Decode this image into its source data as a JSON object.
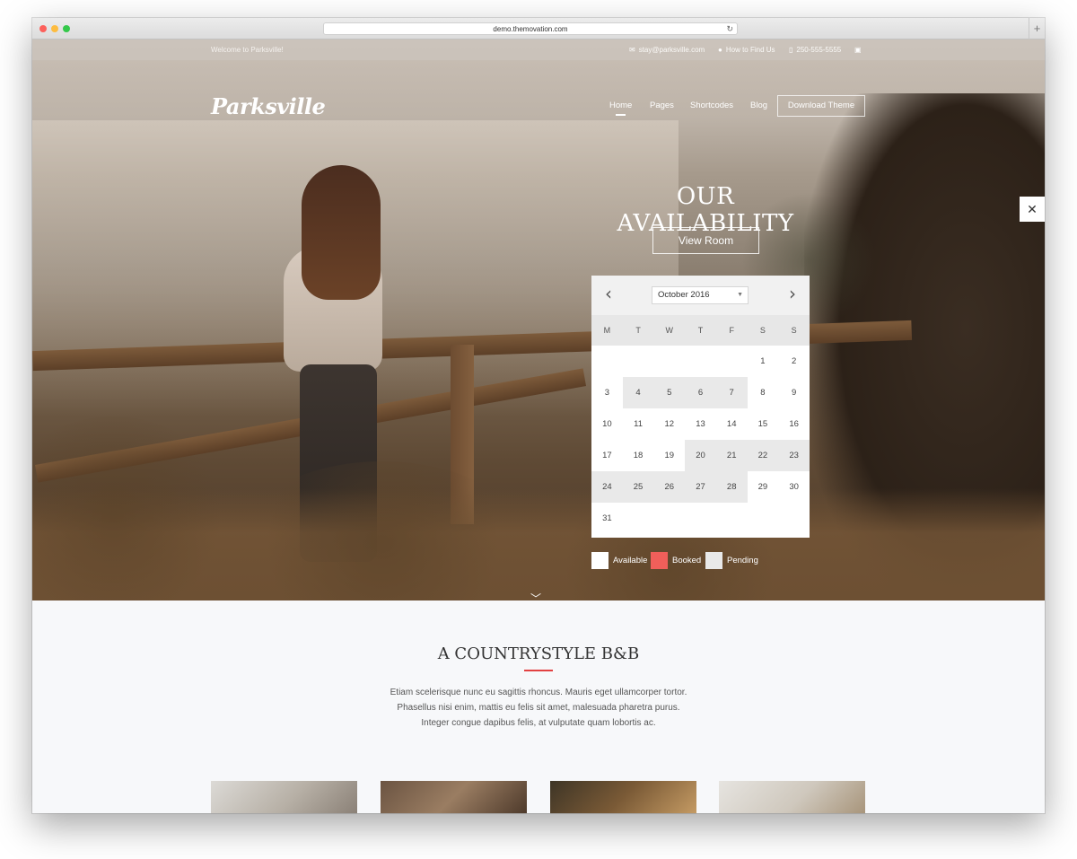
{
  "browser": {
    "url": "demo.themovation.com"
  },
  "topbar": {
    "welcome": "Welcome to Parksville!",
    "email": "stay@parksville.com",
    "find_us": "How to Find Us",
    "phone": "250-555-5555"
  },
  "header": {
    "logo": "Parksville",
    "nav": [
      "Home",
      "Pages",
      "Shortcodes",
      "Blog"
    ],
    "download": "Download Theme"
  },
  "hero": {
    "title": "OUR AVAILABILITY",
    "button": "View Room"
  },
  "calendar": {
    "month": "October 2016",
    "weekdays": [
      "M",
      "T",
      "W",
      "T",
      "F",
      "S",
      "S"
    ],
    "leading_blanks": 5,
    "days": [
      {
        "d": "1",
        "s": "available"
      },
      {
        "d": "2",
        "s": "available"
      },
      {
        "d": "3",
        "s": "available"
      },
      {
        "d": "4",
        "s": "pending"
      },
      {
        "d": "5",
        "s": "pending"
      },
      {
        "d": "6",
        "s": "pending"
      },
      {
        "d": "7",
        "s": "pending"
      },
      {
        "d": "8",
        "s": "available"
      },
      {
        "d": "9",
        "s": "available"
      },
      {
        "d": "10",
        "s": "available"
      },
      {
        "d": "11",
        "s": "available"
      },
      {
        "d": "12",
        "s": "available"
      },
      {
        "d": "13",
        "s": "available"
      },
      {
        "d": "14",
        "s": "available"
      },
      {
        "d": "15",
        "s": "available"
      },
      {
        "d": "16",
        "s": "available"
      },
      {
        "d": "17",
        "s": "available"
      },
      {
        "d": "18",
        "s": "available"
      },
      {
        "d": "19",
        "s": "available"
      },
      {
        "d": "20",
        "s": "pending"
      },
      {
        "d": "21",
        "s": "pending"
      },
      {
        "d": "22",
        "s": "pending"
      },
      {
        "d": "23",
        "s": "pending"
      },
      {
        "d": "24",
        "s": "pending"
      },
      {
        "d": "25",
        "s": "pending"
      },
      {
        "d": "26",
        "s": "pending"
      },
      {
        "d": "27",
        "s": "pending"
      },
      {
        "d": "28",
        "s": "pending"
      },
      {
        "d": "29",
        "s": "available"
      },
      {
        "d": "30",
        "s": "available"
      },
      {
        "d": "31",
        "s": "available"
      }
    ]
  },
  "legend": {
    "available": "Available",
    "booked": "Booked",
    "pending": "Pending",
    "colors": {
      "available": "#ffffff",
      "booked": "#f05f5a",
      "pending": "#e9e9e9"
    }
  },
  "section": {
    "title": "A COUNTRYSTYLE B&B",
    "lines": [
      "Etiam scelerisque nunc eu sagittis rhoncus. Mauris eget ullamcorper tortor.",
      "Phasellus nisi enim, mattis eu felis sit amet, malesuada pharetra purus.",
      "Integer congue dapibus felis, at vulputate quam lobortis ac."
    ]
  },
  "colors": {
    "accent": "#e24141"
  }
}
